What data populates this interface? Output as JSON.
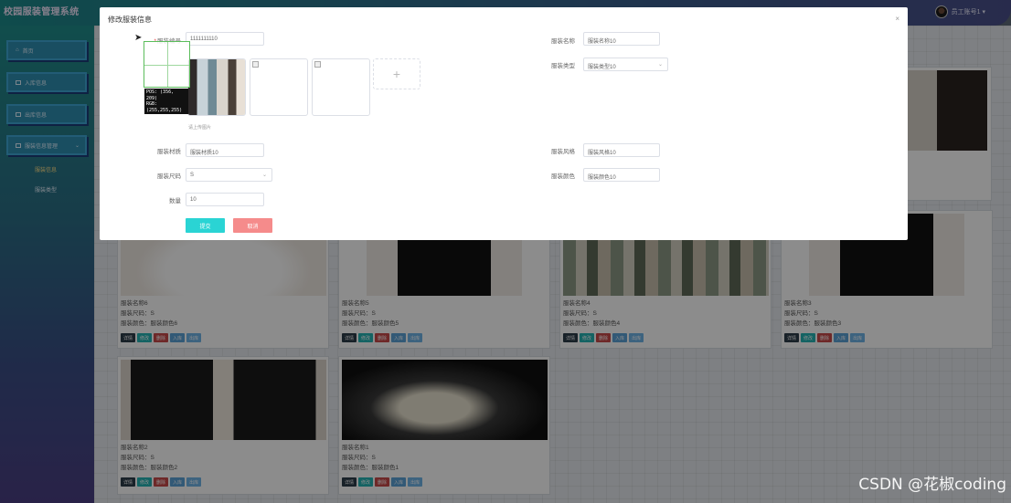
{
  "app": {
    "title": "校园服装管理系统"
  },
  "user": {
    "name": "员工账号1 ▾"
  },
  "sidebar": {
    "items": [
      {
        "label": "首页",
        "icon": "home-icon"
      },
      {
        "label": "入库信息",
        "icon": "list-icon"
      },
      {
        "label": "出库信息",
        "icon": "list-icon"
      },
      {
        "label": "服装信息管理",
        "icon": "folder-icon"
      }
    ],
    "subitems": [
      {
        "label": "服装信息"
      },
      {
        "label": "服装类型"
      }
    ]
  },
  "cards": [
    {
      "name": "服装名称6",
      "size": "服装尺码：S",
      "color": "服装颜色：服装颜色6"
    },
    {
      "name": "服装名称5",
      "size": "服装尺码：S",
      "color": "服装颜色：服装颜色5"
    },
    {
      "name": "服装名称4",
      "size": "服装尺码：S",
      "color": "服装颜色：服装颜色4"
    },
    {
      "name": "服装名称3",
      "size": "服装尺码：S",
      "color": "服装颜色：服装颜色3"
    },
    {
      "name": "服装名称2",
      "size": "服装尺码：S",
      "color": "服装颜色：服装颜色2"
    },
    {
      "name": "服装名称1",
      "size": "服装尺码：S",
      "color": "服装颜色：服装颜色1"
    }
  ],
  "card_buttons": {
    "detail": "详情",
    "edit": "修改",
    "delete": "删除",
    "in": "入库",
    "out": "出库"
  },
  "modal": {
    "title": "修改服装信息",
    "close": "×",
    "fields": {
      "code": {
        "label": "服装编号",
        "value": "1111111110"
      },
      "name": {
        "label": "服装名称",
        "value": "服装名称10"
      },
      "image": {
        "label": "服装图片"
      },
      "type": {
        "label": "服装类型",
        "value": "服装类型10"
      },
      "material": {
        "label": "服装材质",
        "value": "服装材质10"
      },
      "style": {
        "label": "服装风格",
        "value": "服装风格10"
      },
      "size": {
        "label": "服装尺码",
        "value": "S"
      },
      "color": {
        "label": "服装颜色",
        "value": "服装颜色10"
      },
      "qty": {
        "label": "数量",
        "value": "10"
      }
    },
    "upload_hint": "请上传图片",
    "upload_plus": "+",
    "submit": "提交",
    "cancel": "取消"
  },
  "magnifier": {
    "pos": "POS: (356, 209)",
    "rgb": "RGB: (255,255,255)"
  },
  "watermark": "CSDN @花椒coding",
  "colors": {
    "accent": "#2ad4d4",
    "danger": "#f58b8b",
    "sidebar": "#2f8fb1"
  }
}
